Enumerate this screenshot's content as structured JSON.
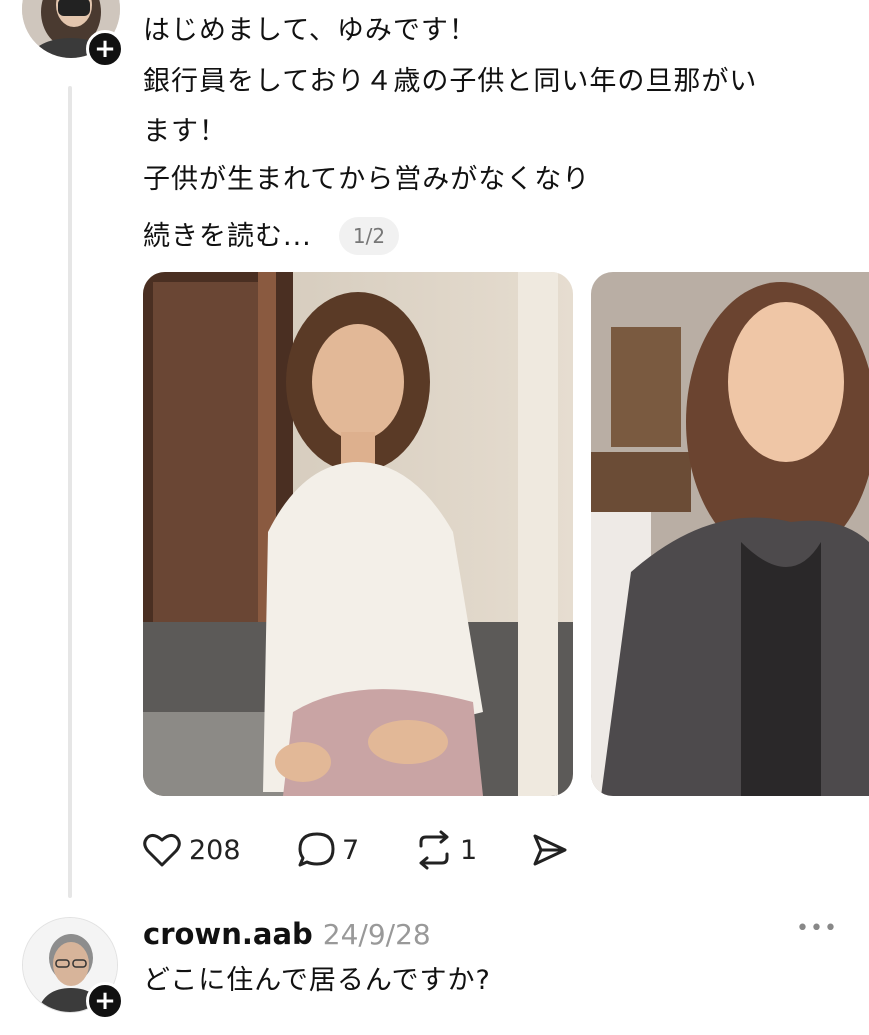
{
  "post": {
    "lines": [
      "はじめまして、ゆみです！",
      "銀行員をしており４歳の子供と同い年の旦那がい",
      "ます！",
      "子供が生まれてから営みがなくなり",
      "続きを読む..."
    ],
    "page_indicator": "1/2",
    "photos": [
      {
        "alt": "woman-in-white-lace-blouse"
      },
      {
        "alt": "woman-in-patterned-cardigan"
      }
    ],
    "actions": {
      "likes": "208",
      "comments": "7",
      "reposts": "1"
    }
  },
  "reply": {
    "username": "crown.aab",
    "date": "24/9/28",
    "text": "どこに住んで居るんですか?",
    "more_label": "•••"
  },
  "icons": {
    "like": "heart-icon",
    "comment": "comment-bubble-icon",
    "repost": "repost-icon",
    "share": "send-icon",
    "follow": "plus-icon",
    "more": "more-dots-icon"
  },
  "colors": {
    "text": "#111111",
    "muted": "#999999",
    "badge_bg": "#f1f1f1",
    "thread_line": "#e6e6e6"
  }
}
